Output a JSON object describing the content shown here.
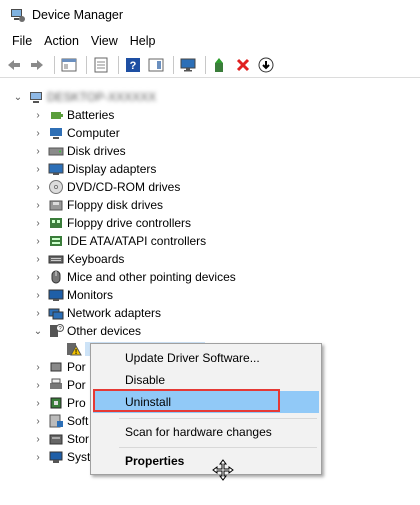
{
  "window": {
    "title": "Device Manager"
  },
  "menu": [
    "File",
    "Action",
    "View",
    "Help"
  ],
  "toolbar": {
    "icons": [
      "back-arrow-icon",
      "forward-arrow-icon",
      "show-hide-console-tree-icon",
      "properties-icon",
      "help-icon",
      "action-pane-icon",
      "monitor-scan-icon",
      "update-driver-icon",
      "uninstall-x-icon",
      "download-icon"
    ],
    "accent_red": "#e53935"
  },
  "tree": {
    "root": {
      "label": "DESKTOP-XXXXXX",
      "expanded": true
    },
    "categories": [
      {
        "label": "Batteries",
        "icon": "battery-icon"
      },
      {
        "label": "Computer",
        "icon": "computer-icon"
      },
      {
        "label": "Disk drives",
        "icon": "disk-drive-icon"
      },
      {
        "label": "Display adapters",
        "icon": "display-adapter-icon"
      },
      {
        "label": "DVD/CD-ROM drives",
        "icon": "dvd-icon"
      },
      {
        "label": "Floppy disk drives",
        "icon": "floppy-disk-icon"
      },
      {
        "label": "Floppy drive controllers",
        "icon": "floppy-controller-icon"
      },
      {
        "label": "IDE ATA/ATAPI controllers",
        "icon": "ide-controller-icon"
      },
      {
        "label": "Keyboards",
        "icon": "keyboard-icon"
      },
      {
        "label": "Mice and other pointing devices",
        "icon": "mouse-icon"
      },
      {
        "label": "Monitors",
        "icon": "monitor-icon"
      },
      {
        "label": "Network adapters",
        "icon": "network-adapter-icon"
      },
      {
        "label": "Other devices",
        "icon": "other-devices-icon",
        "expanded": true
      }
    ],
    "other_devices_child": {
      "label": "",
      "icon": "warning-device-icon"
    },
    "partial_after": [
      {
        "label": "Por",
        "icon": "port-icon"
      },
      {
        "label": "Por",
        "icon": "print-icon"
      },
      {
        "label": "Pro",
        "icon": "processor-icon"
      },
      {
        "label": "Soft",
        "icon": "software-device-icon"
      },
      {
        "label": "Stor",
        "icon": "storage-icon"
      },
      {
        "label": "Syst",
        "icon": "system-devices-icon"
      }
    ]
  },
  "context_menu": {
    "items": [
      {
        "label": "Update Driver Software..."
      },
      {
        "label": "Disable"
      },
      {
        "label": "Uninstall",
        "highlighted": true
      },
      {
        "label": "Scan for hardware changes"
      },
      {
        "label": "Properties",
        "bold": true
      }
    ],
    "highlight_color": "#91c9f7"
  }
}
